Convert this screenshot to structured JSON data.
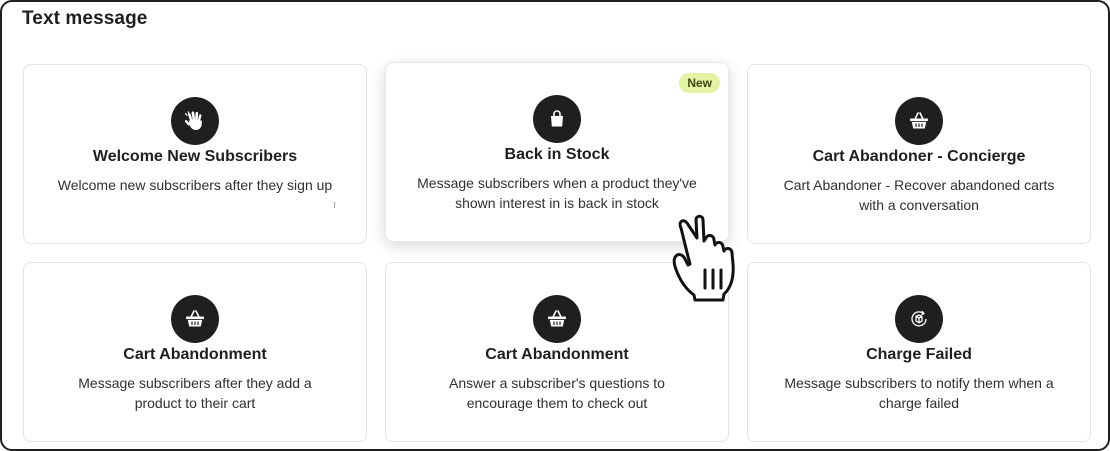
{
  "section": {
    "title": "Text message"
  },
  "cards": [
    {
      "title": "Welcome New Subscribers",
      "description": "Welcome new subscribers after they sign up",
      "icon": "waving-hand-icon"
    },
    {
      "title": "Back in Stock",
      "description": "Message subscribers when a product they've shown interest in is back in stock",
      "icon": "shopping-bag-icon",
      "badge": "New"
    },
    {
      "title": "Cart Abandoner - Concierge",
      "description": "Cart Abandoner - Recover abandoned carts with a conversation",
      "icon": "basket-icon"
    },
    {
      "title": "Cart Abandonment",
      "description": "Message subscribers after they add a product to their cart",
      "icon": "basket-icon"
    },
    {
      "title": "Cart Abandonment",
      "description": "Answer a subscriber's questions to encourage them to check out",
      "icon": "basket-icon"
    },
    {
      "title": "Charge Failed",
      "description": "Message subscribers to notify them when a charge failed",
      "icon": "failed-payment-icon"
    }
  ],
  "colors": {
    "icon_bg": "#1e1f21",
    "badge_bg": "#e4f2a3",
    "text": "#1e1f21",
    "card_border": "#e3e4e6"
  },
  "cursor": "pointer-hand-icon"
}
